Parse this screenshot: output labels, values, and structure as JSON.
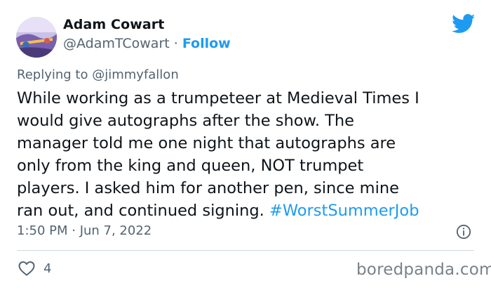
{
  "author": {
    "display_name": "Adam Cowart",
    "handle": "@AdamTCowart",
    "separator": "·",
    "follow_label": "Follow"
  },
  "reply": {
    "prefix": "Replying to",
    "handle": "@jimmyfallon"
  },
  "tweet": {
    "lines": [
      "While working as a trumpeteer at Medieval Times I",
      "would give autographs after the show. The",
      "manager told me one night that autographs are",
      "only from the king and queen, NOT trumpet",
      "players. I asked him for another pen, since mine",
      "ran out, and continued signing."
    ],
    "hashtag": "#WorstSummerJob",
    "timestamp": "1:50 PM · Jun 7, 2022"
  },
  "engagement": {
    "like_count": "4"
  },
  "watermark": "boredpanda.com",
  "colors": {
    "accent": "#1d9bf0",
    "text": "#0f1419",
    "muted": "#536471"
  },
  "icons": [
    "twitter-bird-icon",
    "info-icon",
    "heart-icon"
  ]
}
